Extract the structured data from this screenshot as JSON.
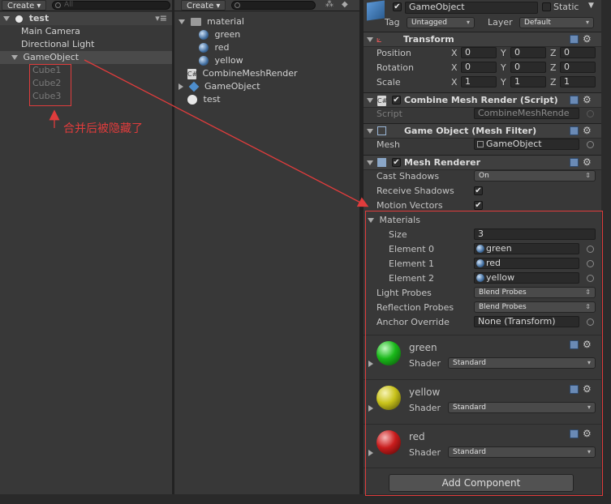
{
  "hierarchy": {
    "create_label": "Create ▾",
    "search_placeholder": "All",
    "scene": "test",
    "items": [
      "Main Camera",
      "Directional Light",
      "GameObject"
    ],
    "hidden_children": [
      "Cube1",
      "Cube2",
      "Cube3"
    ]
  },
  "annotation": {
    "text": "合并后被隐藏了",
    "color": "#e03c3c"
  },
  "project": {
    "create_label": "Create ▾",
    "items": [
      {
        "label": "material",
        "icon": "folder-icon"
      },
      {
        "label": "green",
        "icon": "material-sphere-icon"
      },
      {
        "label": "red",
        "icon": "material-sphere-icon"
      },
      {
        "label": "yellow",
        "icon": "material-sphere-icon"
      },
      {
        "label": "CombineMeshRender",
        "icon": "csharp-script-icon"
      },
      {
        "label": "GameObject",
        "icon": "prefab-icon"
      },
      {
        "label": "test",
        "icon": "unity-scene-icon"
      }
    ]
  },
  "inspector": {
    "object_name": "GameObject",
    "static_label": "Static",
    "tag_label": "Tag",
    "tag_value": "Untagged",
    "layer_label": "Layer",
    "layer_value": "Default",
    "transform": {
      "title": "Transform",
      "rows": [
        {
          "label": "Position",
          "x": "0",
          "y": "0",
          "z": "0"
        },
        {
          "label": "Rotation",
          "x": "0",
          "y": "0",
          "z": "0"
        },
        {
          "label": "Scale",
          "x": "1",
          "y": "1",
          "z": "1"
        }
      ],
      "axis_x": "X",
      "axis_y": "Y",
      "axis_z": "Z"
    },
    "combine_script": {
      "title": "Combine Mesh Render (Script)",
      "script_label": "Script",
      "script_value": "CombineMeshRende"
    },
    "mesh_filter": {
      "title": "Game Object (Mesh Filter)",
      "mesh_label": "Mesh",
      "mesh_value": "GameObject"
    },
    "mesh_renderer": {
      "title": "Mesh Renderer",
      "cast_shadows_label": "Cast Shadows",
      "cast_shadows_value": "On",
      "receive_shadows_label": "Receive Shadows",
      "motion_vectors_label": "Motion Vectors",
      "materials_label": "Materials",
      "size_label": "Size",
      "size_value": "3",
      "elements": [
        {
          "label": "Element 0",
          "value": "green"
        },
        {
          "label": "Element 1",
          "value": "red"
        },
        {
          "label": "Element 2",
          "value": "yellow"
        }
      ],
      "light_probes_label": "Light Probes",
      "light_probes_value": "Blend Probes",
      "reflection_probes_label": "Reflection Probes",
      "reflection_probes_value": "Blend Probes",
      "anchor_override_label": "Anchor Override",
      "anchor_override_value": "None (Transform)"
    },
    "materials": [
      {
        "name": "green",
        "shader_label": "Shader",
        "shader_value": "Standard",
        "color": "#19b819"
      },
      {
        "name": "yellow",
        "shader_label": "Shader",
        "shader_value": "Standard",
        "color": "#c8c21a"
      },
      {
        "name": "red",
        "shader_label": "Shader",
        "shader_value": "Standard",
        "color": "#c81c1c"
      }
    ],
    "add_component_label": "Add Component"
  },
  "check_mark": "✔"
}
